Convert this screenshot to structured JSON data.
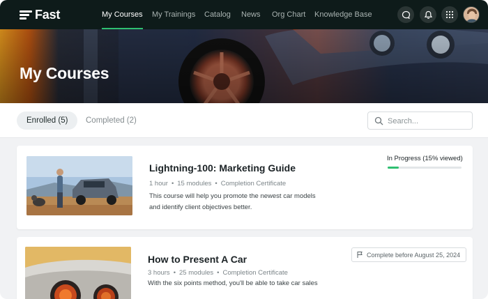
{
  "brand": {
    "name": "Fast"
  },
  "nav": {
    "links": [
      {
        "label": "My Courses",
        "active": true
      },
      {
        "label": "My Trainings"
      },
      {
        "label": "Catalog"
      },
      {
        "label": "News"
      },
      {
        "label": "Org Chart"
      },
      {
        "label": "Knowledge Base"
      }
    ],
    "icons": [
      "chat-icon",
      "bell-icon",
      "apps-grid-icon",
      "user-avatar"
    ]
  },
  "hero": {
    "title": "My Courses"
  },
  "tabs": [
    {
      "label": "Enrolled (5)",
      "active": true
    },
    {
      "label": "Completed (2)"
    }
  ],
  "search": {
    "placeholder": "Search..."
  },
  "courses": [
    {
      "title": "Lightning-100: Marketing Guide",
      "duration": "1 hour",
      "modules": "15 modules",
      "certificate": "Completion Certificate",
      "description": "This course will help you promote the newest car models and identify client objectives better.",
      "status": "In Progress (15% viewed)",
      "progress": 0.15
    },
    {
      "title": "How to Present A Car",
      "duration": "3 hours",
      "modules": "25 modules",
      "certificate": "Completion Certificate",
      "description": "With the six points method, you'll be able to take car sales",
      "due": "Complete before August 25, 2024"
    }
  ],
  "colors": {
    "nav_bg": "#0e1b1a",
    "accent": "#2fbf71",
    "page_bg": "#f1f2f4"
  }
}
